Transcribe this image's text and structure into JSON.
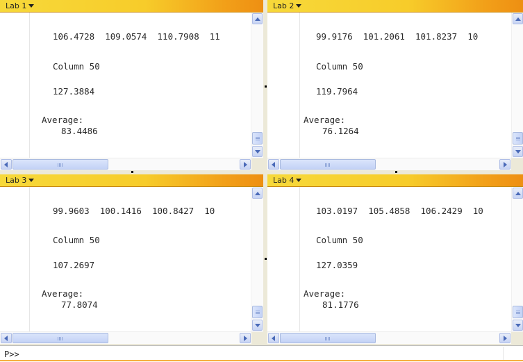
{
  "panes": [
    {
      "title": "Lab 1",
      "values_row": "106.4728  109.0574  110.7908  11",
      "column_label": "Column 50",
      "column_value": "127.3884",
      "average_label": "Average:",
      "average_value": "83.4486"
    },
    {
      "title": "Lab 2",
      "values_row": "99.9176  101.2061  101.8237  10",
      "column_label": "Column 50",
      "column_value": "119.7964",
      "average_label": "Average:",
      "average_value": "76.1264"
    },
    {
      "title": "Lab 3",
      "values_row": "99.9603  100.1416  100.8427  10",
      "column_label": "Column 50",
      "column_value": "107.2697",
      "average_label": "Average:",
      "average_value": "77.8074"
    },
    {
      "title": "Lab 4",
      "values_row": "103.0197  105.4858  106.2429  10",
      "column_label": "Column 50",
      "column_value": "127.0359",
      "average_label": "Average:",
      "average_value": "81.1776"
    }
  ],
  "command": {
    "prompt": "P>>",
    "value": ""
  },
  "colors": {
    "header_start": "#f7d93a",
    "header_end": "#ee8f12",
    "scrollbar": "#c6d3f4"
  },
  "icons": [
    "dropdown-caret-icon",
    "scroll-up-icon",
    "scroll-down-icon",
    "scroll-left-icon",
    "scroll-right-icon"
  ]
}
